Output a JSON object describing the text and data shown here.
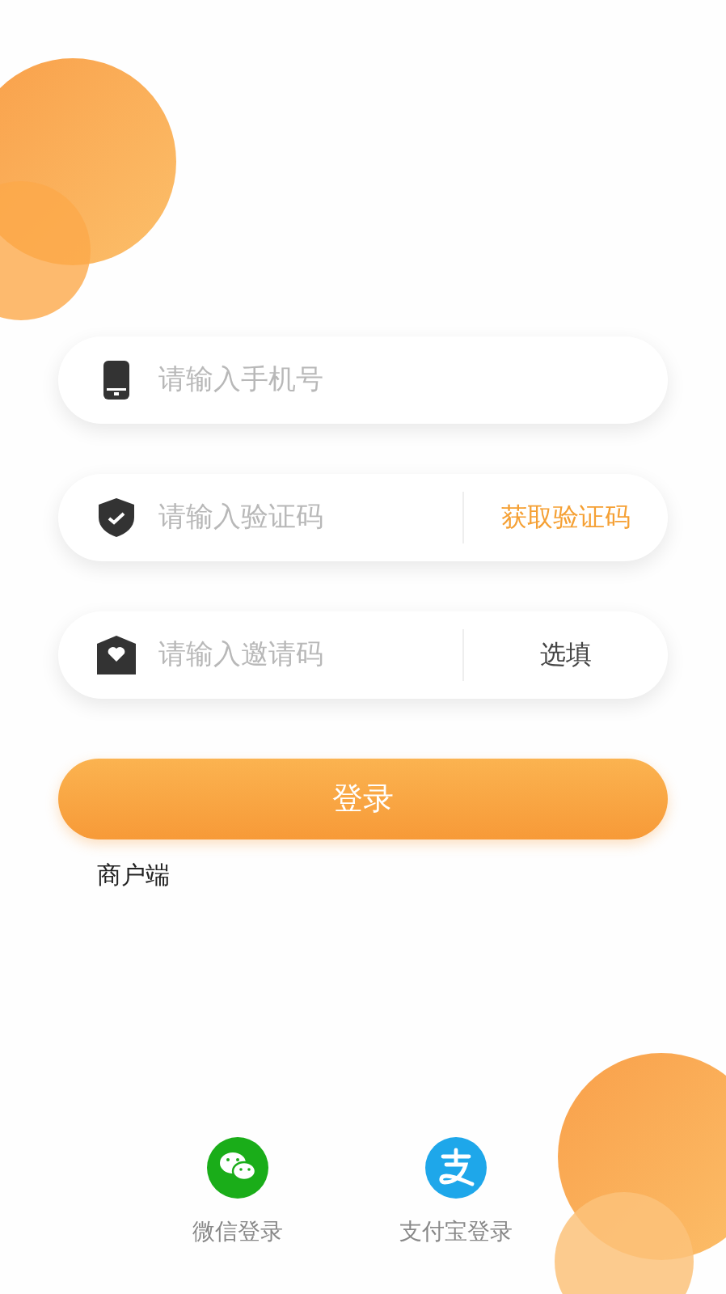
{
  "fields": [
    {
      "kind": "phone",
      "placeholder": "请输入手机号"
    },
    {
      "kind": "code",
      "placeholder": "请输入验证码",
      "action": "获取验证码"
    },
    {
      "kind": "invite",
      "placeholder": "请输入邀请码",
      "note": "选填"
    }
  ],
  "login_button": "登录",
  "merchant_link": "商户端",
  "social_logins": [
    {
      "kind": "wechat",
      "label": "微信登录"
    },
    {
      "kind": "alipay",
      "label": "支付宝登录"
    }
  ]
}
